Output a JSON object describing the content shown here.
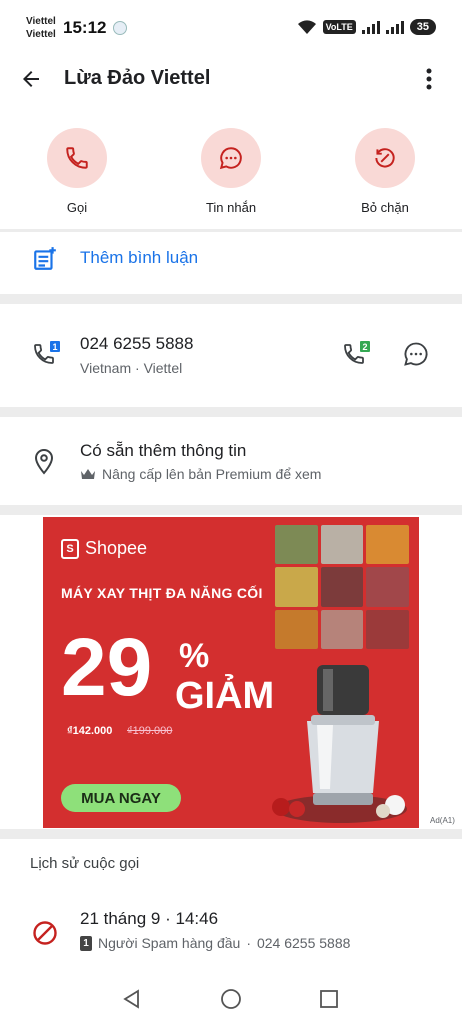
{
  "status_bar": {
    "carrier_1": "Viettel",
    "carrier_2": "Viettel",
    "time": "15:12",
    "volte": "VoLTE",
    "battery": "35"
  },
  "header": {
    "title": "Lừa Đảo Viettel"
  },
  "actions": [
    {
      "label": "Gọi",
      "icon": "phone-icon"
    },
    {
      "label": "Tin nhắn",
      "icon": "message-icon"
    },
    {
      "label": "Bỏ chặn",
      "icon": "unblock-icon"
    }
  ],
  "comment": {
    "label": "Thêm bình luận"
  },
  "number": {
    "value": "024 6255 5888",
    "country": "Vietnam",
    "separator": "·",
    "carrier": "Viettel",
    "sim_1": "1",
    "sim_2": "2"
  },
  "info": {
    "title": "Có sẵn thêm thông tin",
    "subtitle": "Nâng cấp lên bản Premium để xem"
  },
  "ad": {
    "brand": "Shopee",
    "headline": "MÁY XAY THỊT ĐA NĂNG CỐI",
    "discount": "29",
    "percent": "%",
    "discount_label": "GIẢM",
    "price": "₫142.000",
    "old_price": "₫199.000",
    "cta": "MUA NGAY",
    "ad_choice": "Ad(A1)"
  },
  "history": {
    "title": "Lịch sử cuộc gọi",
    "date": "21 tháng 9",
    "separator": "·",
    "time": "14:46",
    "sim": "1",
    "label": "Người Spam hàng đầu",
    "number": "024 6255 5888"
  },
  "colors": {
    "accent": "#1a73e8",
    "action_bg": "#f9d9d6",
    "action_icon": "#c5221f",
    "ad_bg": "#d32f2f",
    "cta": "#8ee07a"
  }
}
